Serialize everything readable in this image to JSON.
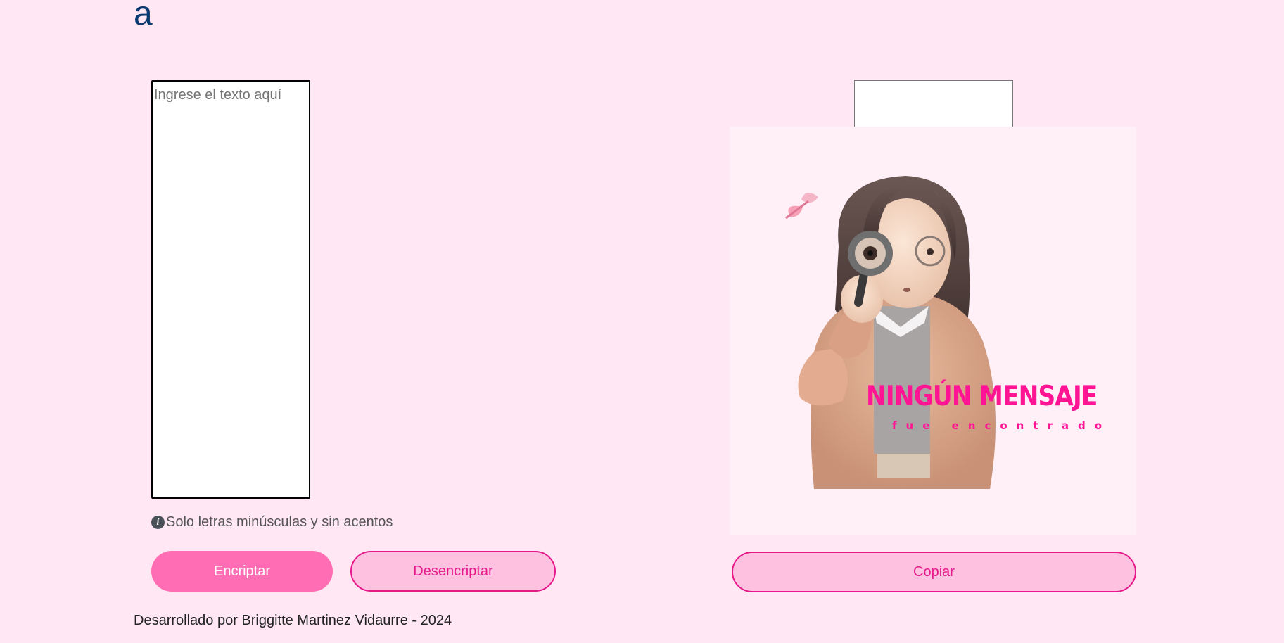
{
  "header": {
    "logo_text": "a"
  },
  "input": {
    "placeholder": "Ingrese el texto aquí",
    "value": ""
  },
  "info": {
    "icon": "info-circle-icon",
    "text": "Solo letras minúsculas y sin acentos"
  },
  "buttons": {
    "encrypt_label": "Encriptar",
    "decrypt_label": "Desencriptar",
    "copy_label": "Copiar"
  },
  "output": {
    "value": "",
    "title": "NINGÚN MENSAJE",
    "subtitle": "fue encontrado"
  },
  "footer": {
    "text": "Desarrollado por Briggitte Martinez Vidaurre - 2024"
  },
  "colors": {
    "background": "#ffe8f4",
    "accent": "#ff6eb4",
    "accent_dark": "#e6198a",
    "logo": "#0a3871"
  }
}
